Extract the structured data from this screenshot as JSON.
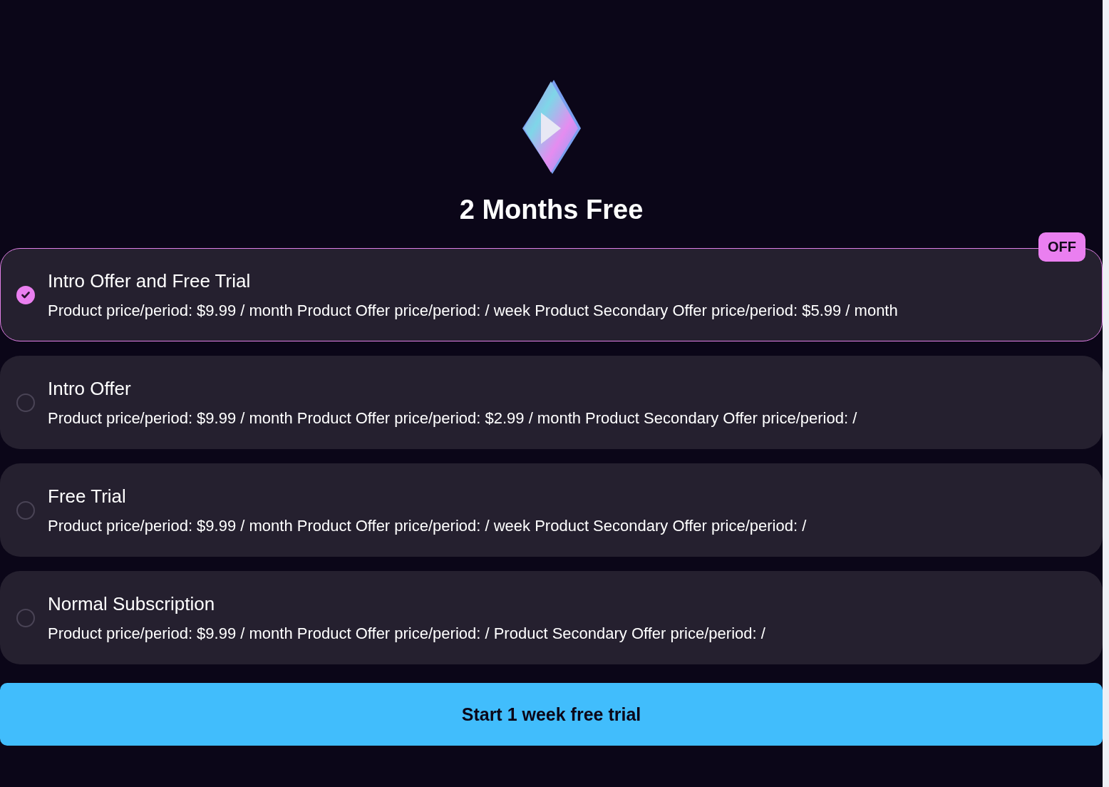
{
  "title": "2 Months Free",
  "options": [
    {
      "name": "Intro Offer and Free Trial",
      "details": "Product price/period: $9.99 / month Product Offer price/period: / week Product Secondary Offer price/period: $5.99 / month",
      "selected": true,
      "badge": "OFF"
    },
    {
      "name": "Intro Offer",
      "details": "Product price/period: $9.99 / month Product Offer price/period: $2.99 / month Product Secondary Offer price/period: /",
      "selected": false
    },
    {
      "name": "Free Trial",
      "details": "Product price/period: $9.99 / month Product Offer price/period: / week Product Secondary Offer price/period: /",
      "selected": false
    },
    {
      "name": "Normal Subscription",
      "details": "Product price/period: $9.99 / month Product Offer price/period: / Product Secondary Offer price/period: /",
      "selected": false
    }
  ],
  "cta": "Start 1 week free trial"
}
